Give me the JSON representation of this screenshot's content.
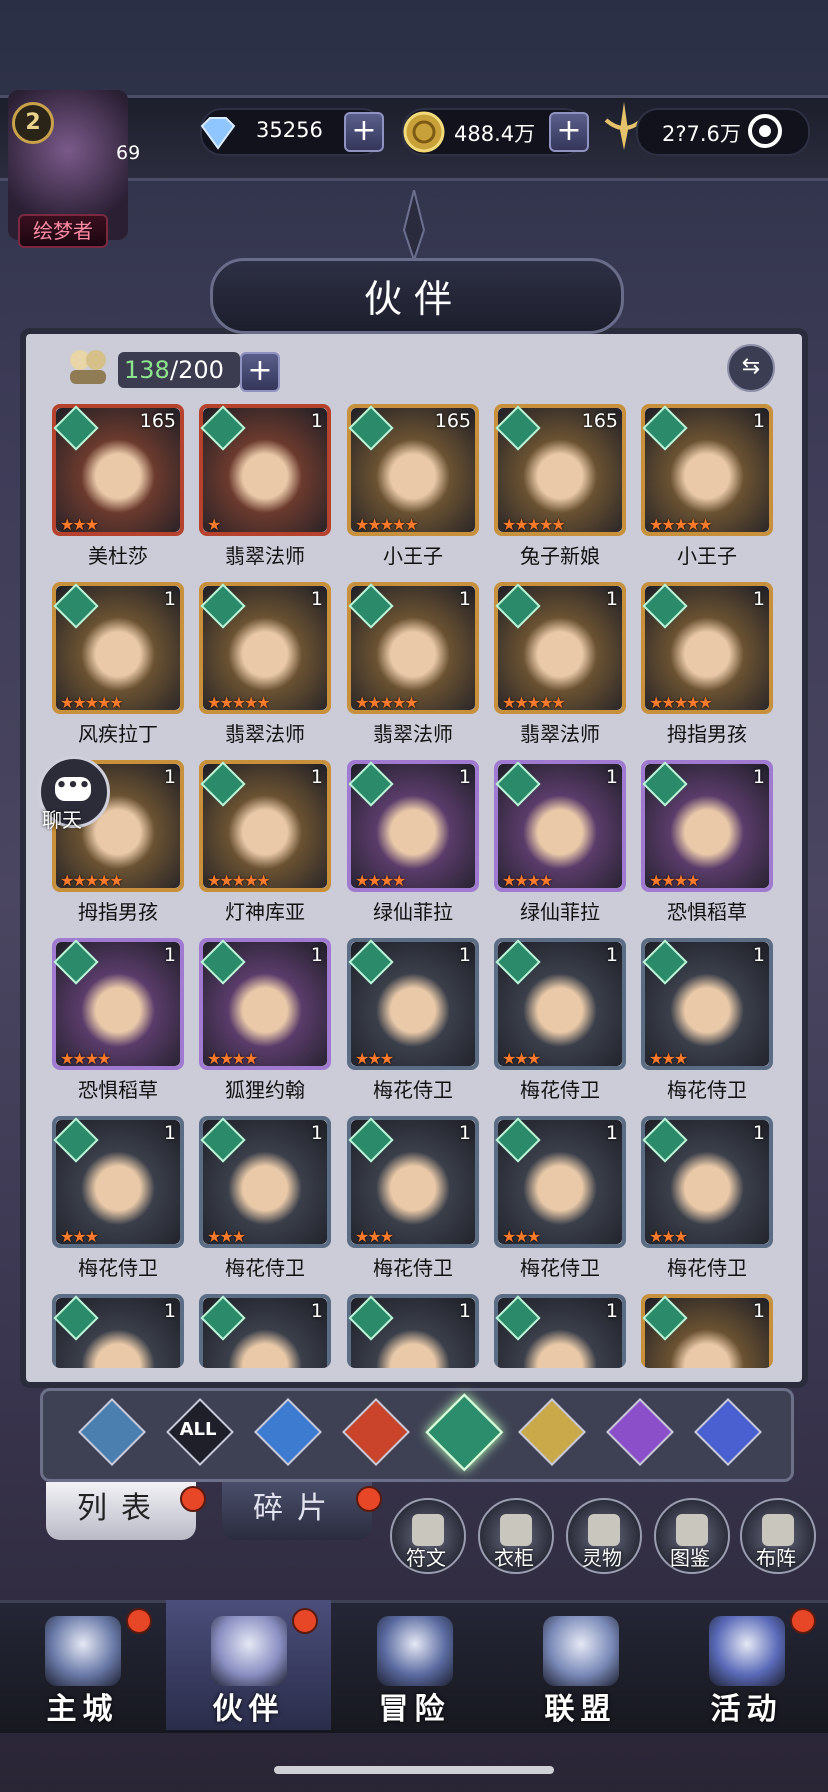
{
  "player": {
    "level": "2",
    "power_level": "69",
    "title": "绘梦者"
  },
  "currency": {
    "diamonds": "35256",
    "gold": "488.4万",
    "other": "2?7.6万"
  },
  "panel": {
    "title": "伙伴"
  },
  "roster": {
    "current": "138",
    "separator_max": "/200"
  },
  "partners": [
    {
      "name": "美杜莎",
      "level": "165",
      "stars": 3,
      "rarity": "red"
    },
    {
      "name": "翡翠法师",
      "level": "1",
      "stars": 1,
      "rarity": "red"
    },
    {
      "name": "小王子",
      "level": "165",
      "stars": 5,
      "rarity": "gold"
    },
    {
      "name": "兔子新娘",
      "level": "165",
      "stars": 5,
      "rarity": "gold"
    },
    {
      "name": "小王子",
      "level": "1",
      "stars": 5,
      "rarity": "gold"
    },
    {
      "name": "风疾拉丁",
      "level": "1",
      "stars": 5,
      "rarity": "gold"
    },
    {
      "name": "翡翠法师",
      "level": "1",
      "stars": 5,
      "rarity": "gold"
    },
    {
      "name": "翡翠法师",
      "level": "1",
      "stars": 5,
      "rarity": "gold"
    },
    {
      "name": "翡翠法师",
      "level": "1",
      "stars": 5,
      "rarity": "gold"
    },
    {
      "name": "拇指男孩",
      "level": "1",
      "stars": 5,
      "rarity": "gold"
    },
    {
      "name": "拇指男孩",
      "level": "1",
      "stars": 5,
      "rarity": "gold"
    },
    {
      "name": "灯神库亚",
      "level": "1",
      "stars": 5,
      "rarity": "gold"
    },
    {
      "name": "绿仙菲拉",
      "level": "1",
      "stars": 4,
      "rarity": "purple"
    },
    {
      "name": "绿仙菲拉",
      "level": "1",
      "stars": 4,
      "rarity": "purple"
    },
    {
      "name": "恐惧稻草",
      "level": "1",
      "stars": 4,
      "rarity": "purple"
    },
    {
      "name": "恐惧稻草",
      "level": "1",
      "stars": 4,
      "rarity": "purple"
    },
    {
      "name": "狐狸约翰",
      "level": "1",
      "stars": 4,
      "rarity": "purple"
    },
    {
      "name": "梅花侍卫",
      "level": "1",
      "stars": 3,
      "rarity": "blue"
    },
    {
      "name": "梅花侍卫",
      "level": "1",
      "stars": 3,
      "rarity": "blue"
    },
    {
      "name": "梅花侍卫",
      "level": "1",
      "stars": 3,
      "rarity": "blue"
    },
    {
      "name": "梅花侍卫",
      "level": "1",
      "stars": 3,
      "rarity": "blue"
    },
    {
      "name": "梅花侍卫",
      "level": "1",
      "stars": 3,
      "rarity": "blue"
    },
    {
      "name": "梅花侍卫",
      "level": "1",
      "stars": 3,
      "rarity": "blue"
    },
    {
      "name": "梅花侍卫",
      "level": "1",
      "stars": 3,
      "rarity": "blue"
    },
    {
      "name": "梅花侍卫",
      "level": "1",
      "stars": 3,
      "rarity": "blue"
    },
    {
      "name": "",
      "level": "1",
      "stars": 0,
      "rarity": "blue"
    },
    {
      "name": "",
      "level": "1",
      "stars": 0,
      "rarity": "blue"
    },
    {
      "name": "",
      "level": "1",
      "stars": 0,
      "rarity": "blue"
    },
    {
      "name": "",
      "level": "1",
      "stars": 0,
      "rarity": "blue"
    },
    {
      "name": "",
      "level": "1",
      "stars": 0,
      "rarity": "gold"
    }
  ],
  "chat": {
    "label": "聊天"
  },
  "filters": [
    {
      "icon": "chevron-up-icon",
      "label": "",
      "color": "#4a7fb0"
    },
    {
      "icon": "all-icon",
      "label": "ALL",
      "color": "#1e1f29"
    },
    {
      "icon": "water-drop-icon",
      "label": "",
      "color": "#3d7bd0"
    },
    {
      "icon": "fire-icon",
      "label": "",
      "color": "#c9442a"
    },
    {
      "icon": "wind-icon",
      "label": "",
      "color": "#2c8d6c"
    },
    {
      "icon": "star-icon",
      "label": "",
      "color": "#c9a94a"
    },
    {
      "icon": "moon-icon",
      "label": "",
      "color": "#8a4fc9"
    },
    {
      "icon": "planet-icon",
      "label": "",
      "color": "#4a5fd0"
    }
  ],
  "tabs": {
    "list": "列表",
    "fragments": "碎片"
  },
  "tools": [
    {
      "label": "符文"
    },
    {
      "label": "衣柜"
    },
    {
      "label": "灵物"
    },
    {
      "label": "图鉴"
    },
    {
      "label": "布阵"
    }
  ],
  "nav": [
    {
      "label": "主城",
      "badge": true
    },
    {
      "label": "伙伴",
      "badge": true
    },
    {
      "label": "冒险",
      "badge": false
    },
    {
      "label": "联盟",
      "badge": false
    },
    {
      "label": "活动",
      "badge": true
    }
  ],
  "colors": {
    "accent_green": "#8de68d",
    "badge_red": "#e74627",
    "panel_bg": "#cbccd8"
  }
}
